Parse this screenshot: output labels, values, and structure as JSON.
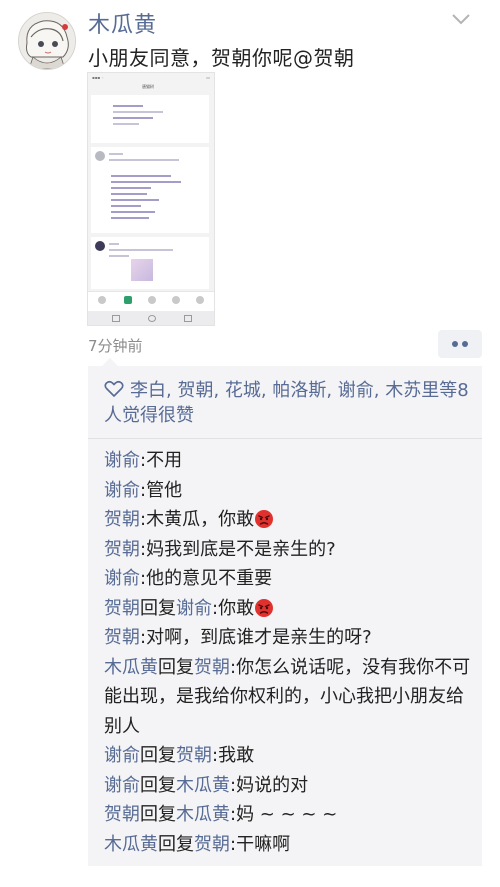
{
  "post": {
    "author": "木瓜黄",
    "text": "小朋友同意，贺朝你呢@贺朝",
    "time": "7分钟前"
  },
  "screenshot_image": {
    "page_title": "唐猫树"
  },
  "likes": {
    "text": "李白, 贺朝, 花城, 帕洛斯, 谢俞, 木苏里等8人觉得很赞"
  },
  "comments": [
    {
      "name": "谢俞",
      "reply_label": "",
      "reply_to": "",
      "sep": ":",
      "text": "不用",
      "emoji": ""
    },
    {
      "name": "谢俞",
      "reply_label": "",
      "reply_to": "",
      "sep": ":",
      "text": "管他",
      "emoji": ""
    },
    {
      "name": "贺朝",
      "reply_label": "",
      "reply_to": "",
      "sep": ":",
      "text": "木黄瓜，你敢",
      "emoji": "angry-face"
    },
    {
      "name": "贺朝",
      "reply_label": "",
      "reply_to": "",
      "sep": ":",
      "text": "妈我到底是不是亲生的?",
      "emoji": ""
    },
    {
      "name": "谢俞",
      "reply_label": "",
      "reply_to": "",
      "sep": ":",
      "text": "他的意见不重要",
      "emoji": ""
    },
    {
      "name": "贺朝",
      "reply_label": "回复",
      "reply_to": "谢俞",
      "sep": ":",
      "text": "你敢",
      "emoji": "angry-face"
    },
    {
      "name": "贺朝",
      "reply_label": "",
      "reply_to": "",
      "sep": ":",
      "text": "对啊，到底谁才是亲生的呀?",
      "emoji": ""
    },
    {
      "name": "木瓜黄",
      "reply_label": "回复",
      "reply_to": "贺朝",
      "sep": ":",
      "text": "你怎么说话呢，没有我你不可能出现，是我给你权利的，小心我把小朋友给别人",
      "emoji": ""
    },
    {
      "name": "谢俞",
      "reply_label": "回复",
      "reply_to": "贺朝",
      "sep": ":",
      "text": "我敢",
      "emoji": ""
    },
    {
      "name": "谢俞",
      "reply_label": "回复",
      "reply_to": "木瓜黄",
      "sep": ":",
      "text": "妈说的对",
      "emoji": ""
    },
    {
      "name": "贺朝",
      "reply_label": "回复",
      "reply_to": "木瓜黄",
      "sep": ":",
      "text": "妈 ~ ~ ~ ~",
      "emoji": ""
    },
    {
      "name": "木瓜黄",
      "reply_label": "回复",
      "reply_to": "贺朝",
      "sep": ":",
      "text": "干嘛啊",
      "emoji": ""
    }
  ],
  "colors": {
    "name_link": "#576b95",
    "comment_bg": "#f4f4f6",
    "time_gray": "#8c8c8c",
    "angry_emoji": "#e0312e"
  }
}
